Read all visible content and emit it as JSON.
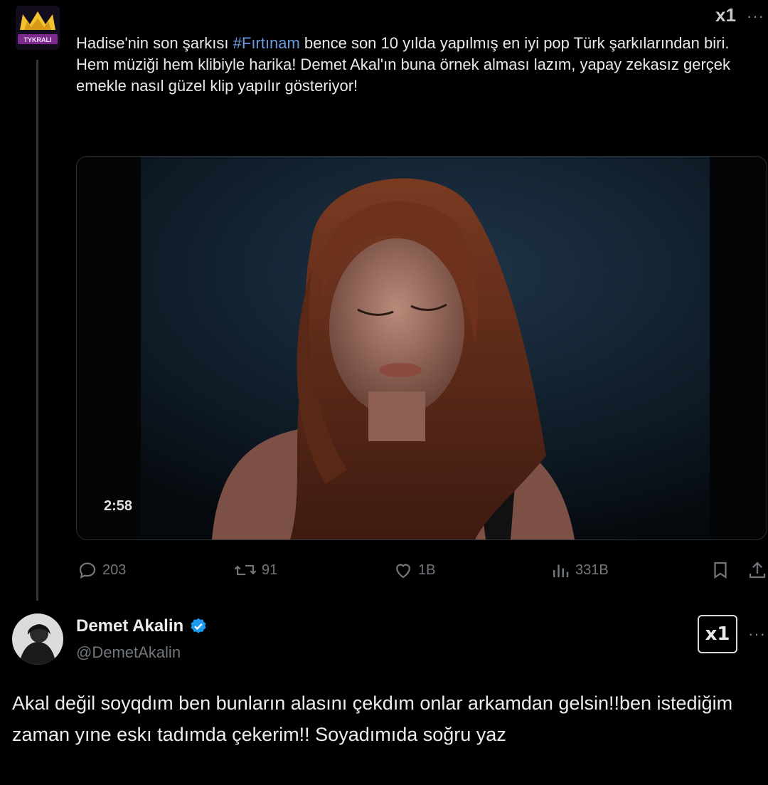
{
  "post": {
    "avatar_label": "TYKRALI",
    "grok_label": "x1",
    "more_label": "···",
    "text_before": "Hadise'nin son şarkısı ",
    "hashtag": "#Fırtınam",
    "text_after": " bence son 10 yılda yapılmış en iyi pop Türk şarkılarından biri. Hem müziği hem klibiyle harika! Demet Akal'ın buna örnek alması lazım, yapay zekasız gerçek emekle nasıl güzel klip yapılır gösteriyor!",
    "video_duration": "2:58",
    "actions": {
      "replies": "203",
      "reposts": "91",
      "likes": "1B",
      "views": "331B"
    }
  },
  "reply": {
    "name": "Demet Akalin",
    "handle": "@DemetAkalin",
    "grok_label": "x1",
    "more_label": "···",
    "text": "Akal değil soyqdım ben bunların alasını çekdım onlar arkamdan gelsin!!ben istediğim zaman yıne eskı tadımda çekerim!! Soyadımıda soğru yaz"
  },
  "colors": {
    "background": "#000000",
    "hashtag": "#6a9be0",
    "verified": "#1d9bf0",
    "muted": "#71767b"
  },
  "icons": [
    "reply-icon",
    "repost-icon",
    "like-icon",
    "views-icon",
    "bookmark-icon",
    "share-icon",
    "verified-badge-icon",
    "grok-icon",
    "more-icon"
  ]
}
